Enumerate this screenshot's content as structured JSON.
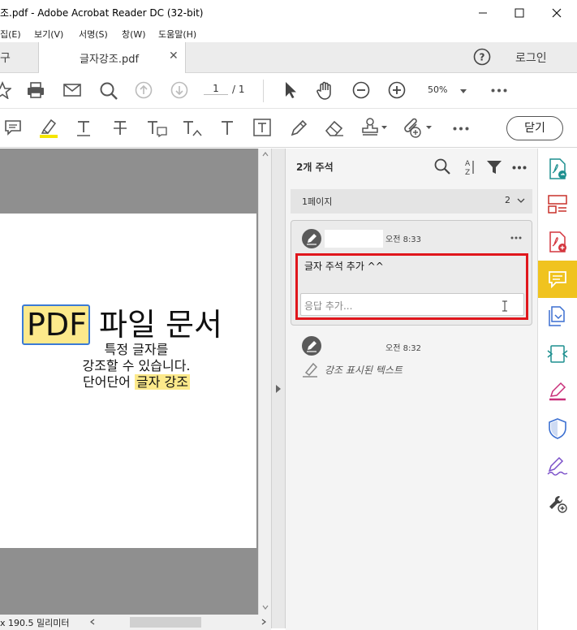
{
  "window": {
    "title": "조.pdf - Adobe Acrobat Reader DC (32-bit)"
  },
  "menu": [
    "집(E)",
    "보기(V)",
    "서명(S)",
    "창(W)",
    "도움말(H)"
  ],
  "tabs": {
    "tools_partial": "구",
    "active": "글자강조.pdf",
    "login": "로그인"
  },
  "toolbar": {
    "page_current": "1",
    "page_total": "/ 1",
    "zoom": "50%",
    "close_label": "닫기"
  },
  "document": {
    "title_highlight": "PDF",
    "title_rest": "파일 문서",
    "line1": "특정 글자를",
    "line2": "강조할 수 있습니다.",
    "line3_prefix": "단어단어",
    "line3_highlight": "글자 강조"
  },
  "status": {
    "size_text": "x 190.5 밀리미터"
  },
  "comments_panel": {
    "header": "2개 주석",
    "page_group": "1페이지",
    "page_group_count": "2",
    "comments": [
      {
        "time": "오전 8:33",
        "text": "글자 주석 추가 ^^",
        "reply_placeholder": "응답 추가..."
      },
      {
        "time": "오전 8:32",
        "text": "강조 표시된 텍스트"
      }
    ]
  },
  "colors": {
    "accent": "#f0c31f",
    "red_box": "#e0161c",
    "highlight": "#fce98b"
  }
}
